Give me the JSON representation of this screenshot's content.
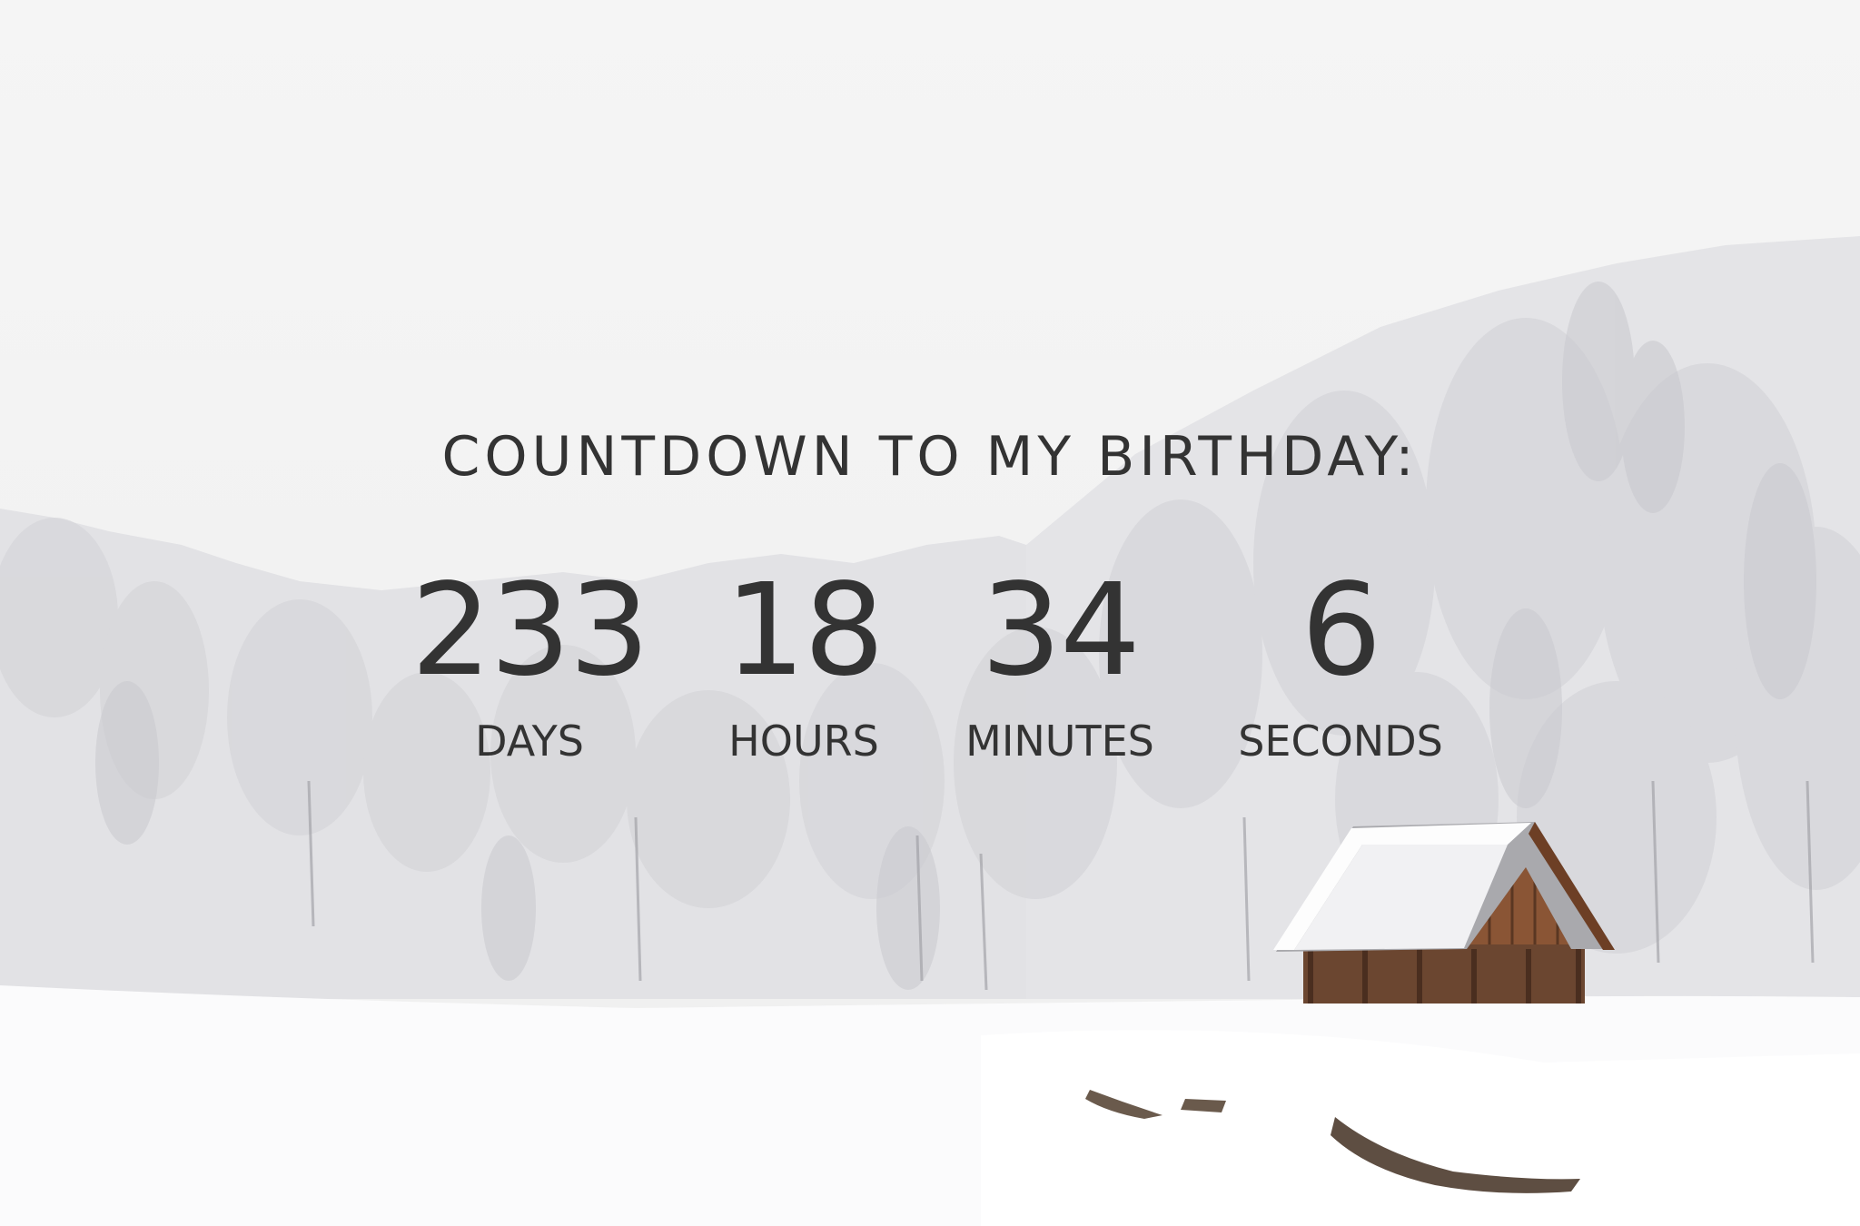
{
  "page": {
    "heading": "COUNTDOWN TO MY BIRTHDAY:"
  },
  "countdown": [
    {
      "value": "233",
      "label": "DAYS"
    },
    {
      "value": "18",
      "label": "HOURS"
    },
    {
      "value": "34",
      "label": "MINUTES"
    },
    {
      "value": "6",
      "label": "SECONDS"
    }
  ],
  "colors": {
    "text": "#333333",
    "sky": "#f4f4f4",
    "snow": "#ffffff",
    "cabin_wood": "#7a4a30"
  }
}
